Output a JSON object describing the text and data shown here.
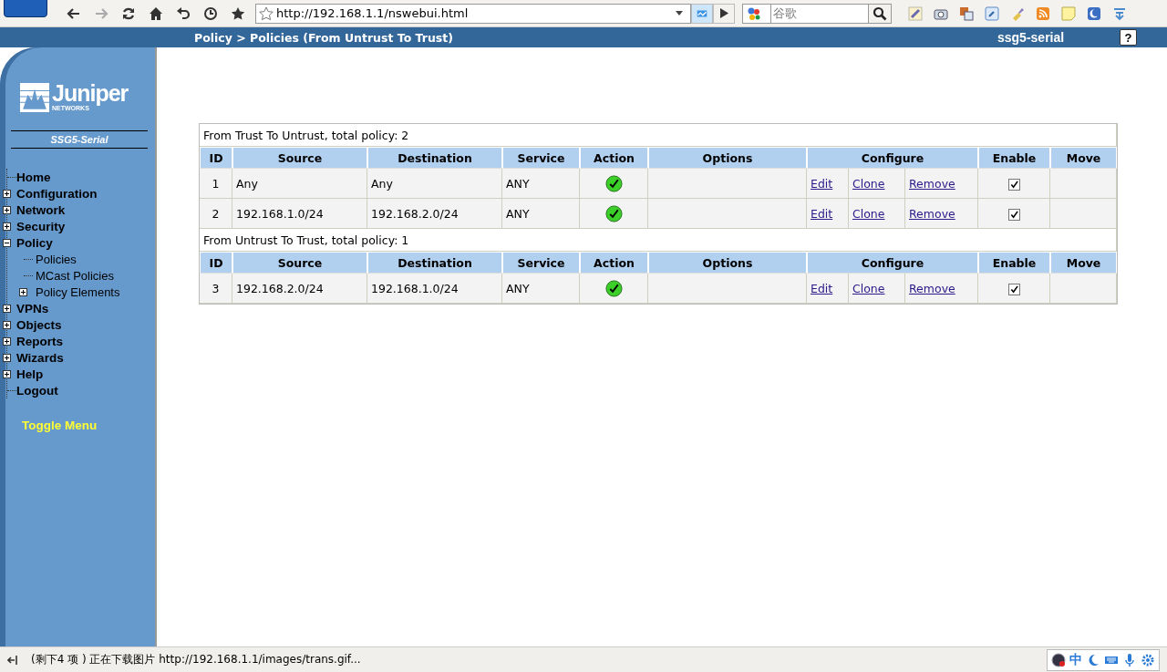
{
  "browser": {
    "url": "http://192.168.1.1/nswebui.html",
    "search_placeholder": "谷歌"
  },
  "header": {
    "breadcrumb": "Policy > Policies (From Untrust To Trust)",
    "device": "ssg5-serial",
    "help": "?"
  },
  "sidebar": {
    "logo": "Juniper",
    "logo_sub": "NETWORKS",
    "model": "SSG5-Serial",
    "toggle": "Toggle Menu",
    "menu": [
      {
        "label": "Home",
        "kind": "leaf"
      },
      {
        "label": "Configuration",
        "kind": "folder",
        "expanded": false
      },
      {
        "label": "Network",
        "kind": "folder",
        "expanded": false
      },
      {
        "label": "Security",
        "kind": "folder",
        "expanded": false
      },
      {
        "label": "Policy",
        "kind": "folder",
        "expanded": true,
        "children": [
          {
            "label": "Policies",
            "kind": "leaf"
          },
          {
            "label": "MCast Policies",
            "kind": "leaf"
          },
          {
            "label": "Policy Elements",
            "kind": "folder",
            "expanded": false
          }
        ]
      },
      {
        "label": "VPNs",
        "kind": "folder",
        "expanded": false
      },
      {
        "label": "Objects",
        "kind": "folder",
        "expanded": false
      },
      {
        "label": "Reports",
        "kind": "folder",
        "expanded": false
      },
      {
        "label": "Wizards",
        "kind": "folder",
        "expanded": false
      },
      {
        "label": "Help",
        "kind": "folder",
        "expanded": false
      },
      {
        "label": "Logout",
        "kind": "leaf"
      }
    ]
  },
  "policy_groups": [
    {
      "title": "From Trust To Untrust, total policy: 2",
      "columns": [
        "ID",
        "Source",
        "Destination",
        "Service",
        "Action",
        "Options",
        "Configure",
        "Enable",
        "Move"
      ],
      "rows": [
        {
          "id": "1",
          "source": "Any",
          "destination": "Any",
          "service": "ANY",
          "permitted": true,
          "links": [
            "Edit",
            "Clone",
            "Remove"
          ],
          "enabled": true
        },
        {
          "id": "2",
          "source": "192.168.1.0/24",
          "destination": "192.168.2.0/24",
          "service": "ANY",
          "permitted": true,
          "links": [
            "Edit",
            "Clone",
            "Remove"
          ],
          "enabled": true
        }
      ]
    },
    {
      "title": "From Untrust To Trust, total policy: 1",
      "columns": [
        "ID",
        "Source",
        "Destination",
        "Service",
        "Action",
        "Options",
        "Configure",
        "Enable",
        "Move"
      ],
      "rows": [
        {
          "id": "3",
          "source": "192.168.2.0/24",
          "destination": "192.168.1.0/24",
          "service": "ANY",
          "permitted": true,
          "links": [
            "Edit",
            "Clone",
            "Remove"
          ],
          "enabled": true
        }
      ]
    }
  ],
  "status_bar": {
    "text": "(剩下4 项 ) 正在下载图片 http://192.168.1.1/images/trans.gif...",
    "ime_label": "中"
  }
}
